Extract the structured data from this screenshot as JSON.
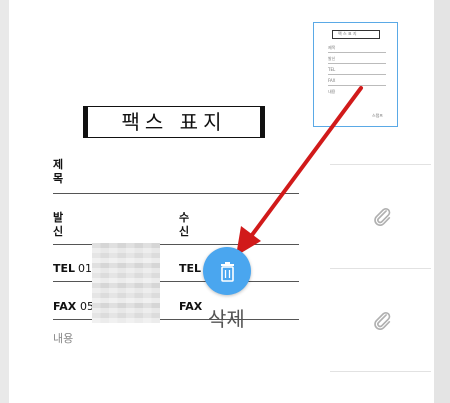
{
  "document": {
    "title": "팩스 표지",
    "subject_label": "제\n목",
    "sender_label": "발\n신",
    "receiver_label": "수\n신",
    "tel_label": "TEL",
    "tel_value": "010",
    "tel_label_right": "TEL",
    "fax_label": "FAX",
    "fax_value": "05",
    "fax_label_right": "FAX",
    "memo_label": "내용"
  },
  "thumbnail": {
    "title": "팩 스 표 지",
    "fields": [
      "제목",
      "발신",
      "TEL",
      "FAX",
      "내용"
    ],
    "stamp": "스탬프"
  },
  "actions": {
    "delete_label": "삭제"
  },
  "colors": {
    "accent": "#4aa6ef",
    "arrow": "#d11a1a"
  },
  "icons": {
    "delete": "trash-icon",
    "attachment": "paperclip-icon"
  }
}
